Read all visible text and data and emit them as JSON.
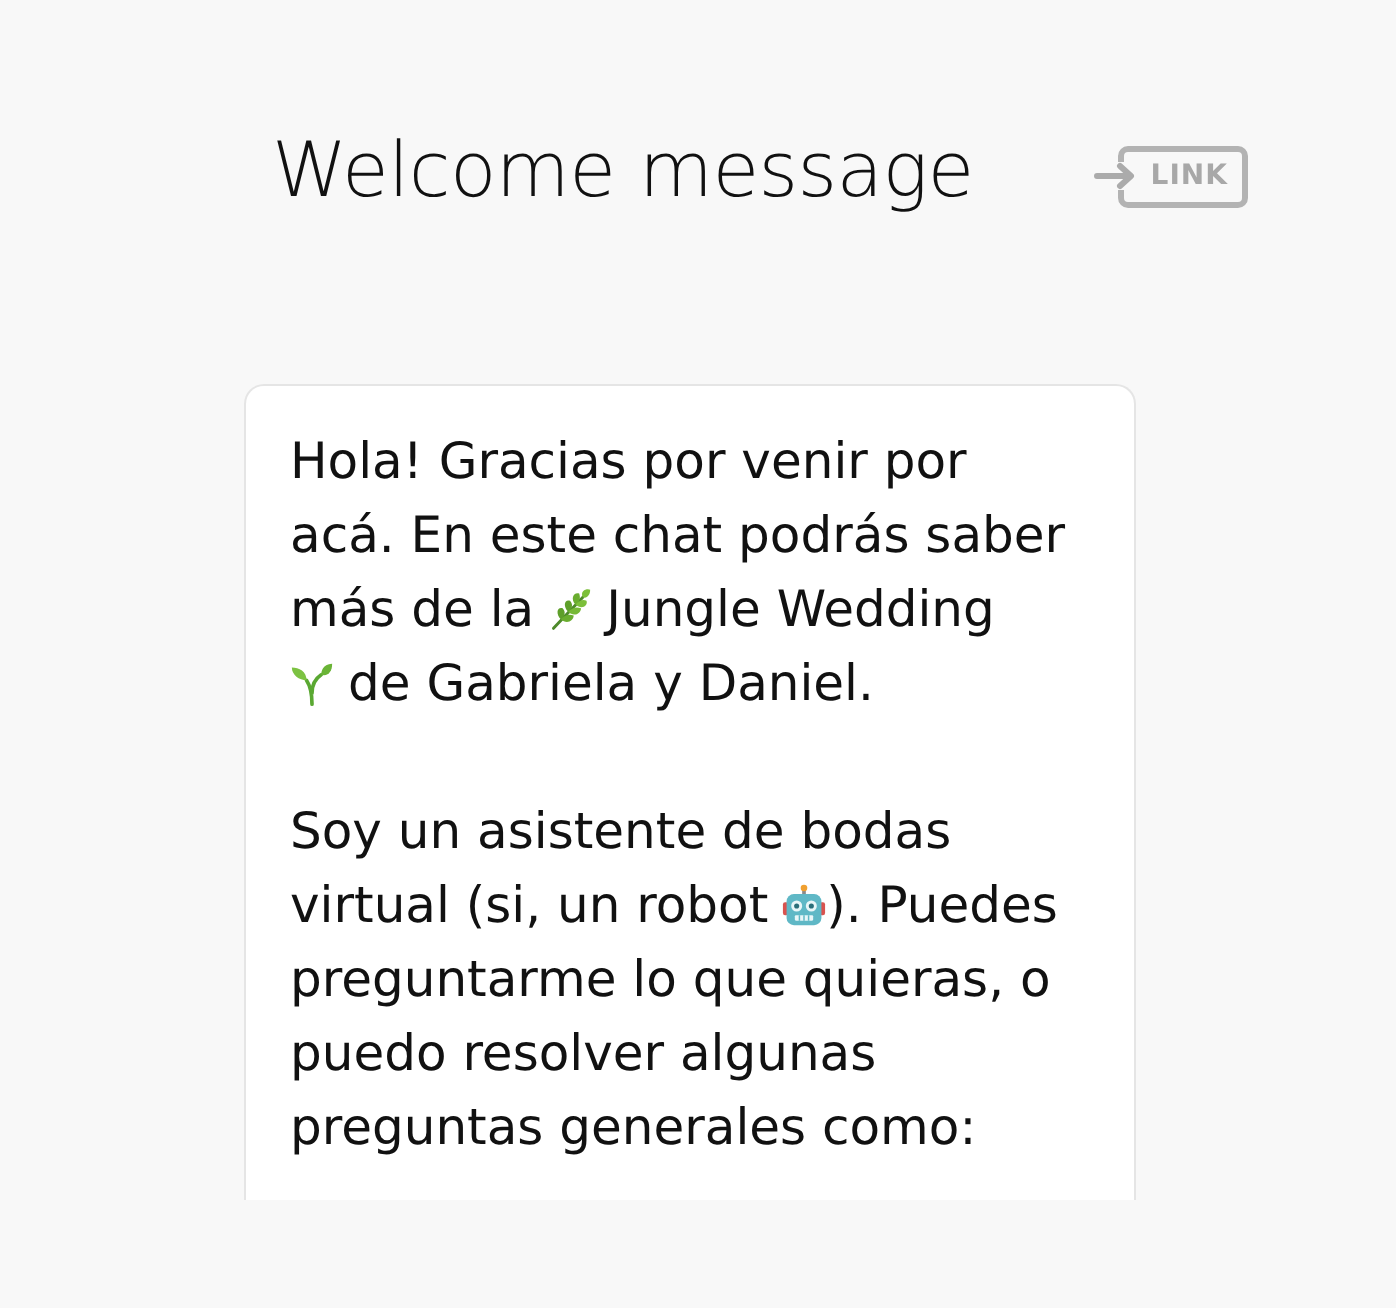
{
  "header": {
    "title": "Welcome message",
    "link_button": "LINK"
  },
  "message": {
    "paragraphs": [
      {
        "lines": [
          [
            {
              "kind": "text",
              "text": "Hola! Gracias por venir por"
            }
          ],
          [
            {
              "kind": "text",
              "text": "acá. En este chat podrás saber"
            }
          ],
          [
            {
              "kind": "text",
              "text": "más de la"
            },
            {
              "kind": "emoji"
            },
            {
              "kind": "text",
              "text": "Jungle Wedding"
            }
          ],
          [
            {
              "kind": "emoji"
            },
            {
              "kind": "text",
              "text": "de Gabriela y Daniel."
            }
          ]
        ]
      },
      {
        "lines": [
          [
            {
              "kind": "text",
              "text": "Soy un asistente de bodas"
            }
          ],
          [
            {
              "kind": "text",
              "text": "virtual (si, un robot"
            },
            {
              "kind": "emoji"
            },
            {
              "kind": "text",
              "text": "). Puedes"
            }
          ],
          [
            {
              "kind": "text",
              "text": "preguntarme lo que quieras, o"
            }
          ],
          [
            {
              "kind": "text",
              "text": "puedo resolver algunas"
            }
          ],
          [
            {
              "kind": "text",
              "text": "preguntas generales como:"
            }
          ]
        ]
      }
    ]
  }
}
